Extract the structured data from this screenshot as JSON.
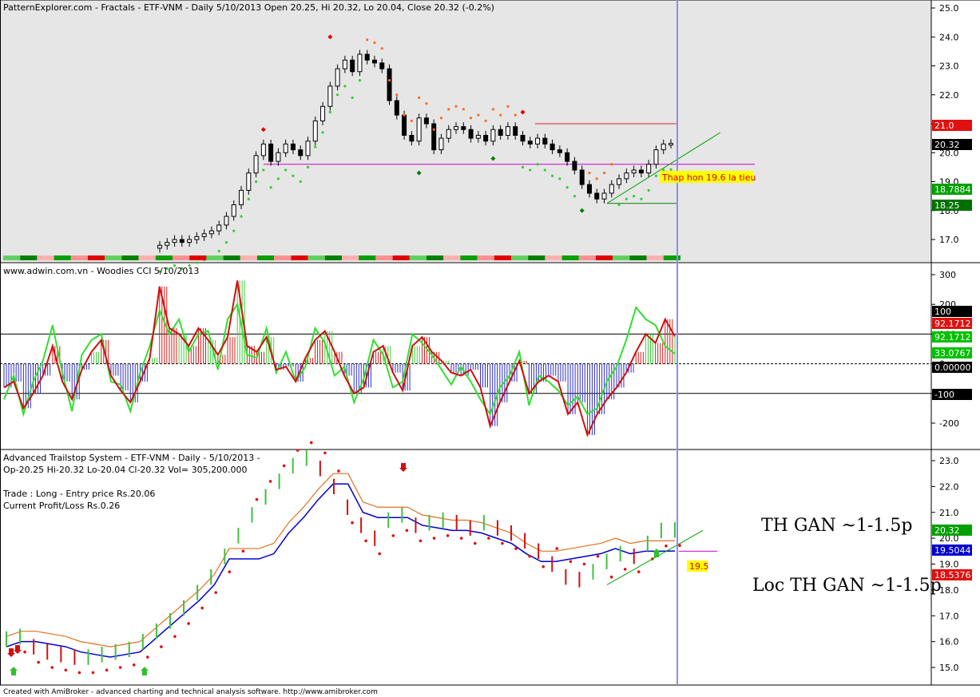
{
  "footer": "Created with AmiBroker - advanced charting and technical analysis software. http://www.amibroker.com",
  "panels": [
    {
      "title": "PatternExplorer.com - Fractals - ETF-VNM - Daily 5/10/2013 Open 20.25, Hi 20.32, Lo 20.04, Close 20.32 (-0.2%)",
      "y_ticks": [
        "25.0",
        "24.0",
        "23.0",
        "22.0",
        "21.0",
        "20.0",
        "19.0",
        "18.0",
        "17.0"
      ],
      "price_tags": [
        {
          "text": "21.0",
          "bg": "#e01010",
          "fg": "#ffffff"
        },
        {
          "text": "20.32",
          "bg": "#000000",
          "fg": "#ffffff"
        },
        {
          "text": "18.7884",
          "bg": "#00a000",
          "fg": "#ffffff"
        },
        {
          "text": "18.25",
          "bg": "#007000",
          "fg": "#ffffff"
        }
      ],
      "annotation": "Thap hon 19.6 la tieu"
    },
    {
      "title": "www.adwin.com.vn - Woodies CCI   5/10/2013",
      "y_ticks": [
        "300",
        "200",
        "100",
        "0",
        "-100",
        "-200"
      ],
      "value_tags": [
        {
          "text": "100",
          "bg": "#000000",
          "fg": "#ffffff"
        },
        {
          "text": "92.1712",
          "bg": "#e01010",
          "fg": "#ffffff"
        },
        {
          "text": "92.1712",
          "bg": "#00c000",
          "fg": "#ffffff"
        },
        {
          "text": "33.0767",
          "bg": "#00c000",
          "fg": "#ffffff"
        },
        {
          "text": "0.00000",
          "bg": "#000000",
          "fg": "#ffffff"
        },
        {
          "text": "-100",
          "bg": "#000000",
          "fg": "#ffffff"
        }
      ]
    },
    {
      "title": "Advanced Trailstop System  - ETF-VNM - Daily  - 5/10/2013 -",
      "ohlc_line": "Op-20.25  Hi-20.32  Lo-20.04  Cl-20.32  Vol= 305,200.000",
      "trade_line": "Trade : Long - Entry price Rs.20.06",
      "pl_line": "Current Profit/Loss Rs.0.26",
      "y_ticks": [
        "23.0",
        "22.0",
        "21.0",
        "20.0",
        "19.0",
        "18.0",
        "17.0",
        "16.0",
        "15.0"
      ],
      "value_tags": [
        {
          "text": "20.32",
          "bg": "#00a000",
          "fg": "#ffffff"
        },
        {
          "text": "19.5044",
          "bg": "#0000cc",
          "fg": "#ffffff"
        },
        {
          "text": "19.5",
          "bg": "#ffff00",
          "fg": "#d00000"
        },
        {
          "text": "18.5376",
          "bg": "#e01010",
          "fg": "#ffffff"
        }
      ],
      "note1": "TH GAN ~1-1.5p",
      "note2": "Loc TH GAN ~1-1.5p"
    }
  ],
  "chart_data": [
    {
      "type": "candlestick",
      "title": "PatternExplorer.com - Fractals - ETF-VNM - Daily 5/10/2013 Open 20.25, Hi 20.32, Lo 20.04, Close 20.32 (-0.2%)",
      "ylim": [
        16.4,
        25.2
      ],
      "series": [
        {
          "name": "ETF-VNM",
          "close": [
            16.8,
            16.9,
            17.0,
            16.9,
            17.0,
            17.1,
            17.2,
            17.3,
            17.5,
            17.8,
            18.2,
            18.7,
            19.3,
            19.9,
            20.3,
            19.7,
            20.0,
            20.3,
            20.1,
            19.9,
            20.4,
            21.1,
            21.6,
            22.3,
            22.9,
            23.2,
            22.8,
            23.4,
            23.2,
            23.1,
            22.9,
            21.8,
            21.3,
            20.6,
            20.4,
            21.2,
            21.0,
            20.1,
            20.5,
            20.8,
            20.9,
            20.8,
            20.5,
            20.6,
            20.4,
            20.8,
            20.6,
            20.9,
            20.6,
            20.4,
            20.3,
            20.5,
            20.3,
            20.1,
            20.0,
            19.7,
            19.4,
            18.9,
            18.6,
            18.4,
            18.6,
            18.9,
            19.1,
            19.3,
            19.4,
            19.3,
            19.6,
            20.1,
            20.3,
            20.32
          ]
        }
      ],
      "fractal_support": 19.6,
      "fractal_resistance": 21.0
    },
    {
      "type": "line",
      "title": "www.adwin.com.vn - Woodies CCI   5/10/2013",
      "ylim": [
        -260,
        320
      ],
      "series": [
        {
          "values": [
            -80,
            -60,
            -150,
            -100,
            -40,
            60,
            -60,
            -120,
            -20,
            40,
            80,
            -40,
            -90,
            -130,
            -60,
            20,
            260,
            120,
            100,
            60,
            120,
            80,
            30,
            90,
            280,
            60,
            40,
            90,
            -20,
            -10,
            -60,
            20,
            80,
            110,
            40,
            -40,
            -100,
            -80,
            40,
            60,
            -30,
            -90,
            60,
            90,
            40,
            10,
            -30,
            -40,
            -20,
            -80,
            -210,
            -130,
            -60,
            10,
            -100,
            -60,
            -40,
            -60,
            -170,
            -130,
            -240,
            -170,
            -120,
            -80,
            -30,
            40,
            100,
            70,
            150,
            92.1712
          ]
        },
        {
          "values": [
            -120,
            -40,
            -170,
            -60,
            10,
            130,
            -30,
            -160,
            30,
            80,
            100,
            -60,
            -70,
            -160,
            -30,
            60,
            180,
            100,
            150,
            40,
            100,
            110,
            -20,
            150,
            200,
            30,
            20,
            120,
            -30,
            40,
            -60,
            -10,
            120,
            70,
            -40,
            -10,
            -130,
            -50,
            80,
            30,
            -80,
            -60,
            100,
            70,
            30,
            -20,
            -70,
            -10,
            -60,
            -120,
            -170,
            -80,
            -40,
            40,
            -140,
            -40,
            -60,
            -90,
            -140,
            -110,
            -170,
            -150,
            -60,
            -10,
            80,
            190,
            150,
            130,
            60,
            33.0767
          ]
        }
      ]
    },
    {
      "type": "line",
      "title": "Advanced Trailstop System  - ETF-VNM - Daily  - 5/10/2013 -",
      "ylim": [
        14.3,
        23.4
      ],
      "series": [
        {
          "values": [
            16.1,
            16.2,
            15.8,
            15.6,
            15.5,
            15.4,
            15.4,
            15.5,
            15.6,
            15.7,
            16.0,
            16.4,
            16.8,
            17.3,
            17.9,
            18.5,
            19.3,
            20.1,
            20.9,
            21.6,
            22.2,
            22.8,
            23.1,
            22.7,
            22.0,
            21.2,
            20.5,
            20.0,
            20.7,
            20.9,
            20.5,
            20.6,
            20.7,
            20.6,
            20.4,
            20.6,
            20.4,
            20.2,
            19.9,
            19.5,
            19.0,
            18.5,
            18.4,
            18.7,
            19.1,
            19.4,
            19.3,
            19.8,
            20.3,
            20.32
          ]
        },
        {
          "values": [
            15.8,
            16.0,
            16.0,
            15.9,
            15.8,
            15.6,
            15.5,
            15.4,
            15.5,
            15.6,
            16.1,
            16.6,
            17.1,
            17.6,
            18.2,
            19.2,
            19.2,
            19.2,
            19.4,
            20.2,
            20.8,
            21.5,
            22.1,
            22.1,
            21.0,
            20.8,
            20.8,
            20.8,
            20.5,
            20.4,
            20.3,
            20.3,
            20.2,
            20.0,
            19.8,
            19.4,
            19.1,
            19.1,
            19.2,
            19.3,
            19.4,
            19.6,
            19.4,
            19.5,
            19.5,
            19.5044
          ]
        }
      ]
    }
  ]
}
